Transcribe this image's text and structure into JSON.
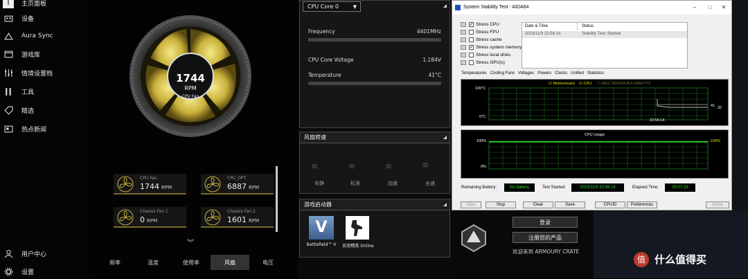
{
  "sidebar": {
    "items": [
      {
        "label": "主页面板",
        "icon": "home-icon"
      },
      {
        "label": "设备",
        "icon": "keyboard-icon"
      },
      {
        "label": "Aura Sync",
        "icon": "aura-icon"
      },
      {
        "label": "游戏库",
        "icon": "library-icon"
      },
      {
        "label": "情境设置档",
        "icon": "sliders-icon"
      },
      {
        "label": "工具",
        "icon": "tools-icon"
      },
      {
        "label": "精选",
        "icon": "tag-icon"
      },
      {
        "label": "热点新闻",
        "icon": "news-icon"
      }
    ],
    "bottom": [
      {
        "label": "用户中心",
        "icon": "user-icon"
      },
      {
        "label": "设置",
        "icon": "gear-icon"
      }
    ]
  },
  "main_fan": {
    "value": "1744",
    "unit": "RPM",
    "label": "CPU Fan"
  },
  "fan_cards": [
    {
      "name": "CPU Fan",
      "value": "1744",
      "unit": "RPM"
    },
    {
      "name": "CPU_OPT",
      "value": "6887",
      "unit": "RPM"
    },
    {
      "name": "Chassis Fan 1",
      "value": "0",
      "unit": "RPM"
    },
    {
      "name": "Chassis Fan 2",
      "value": "1601",
      "unit": "RPM"
    }
  ],
  "bottom_tabs": [
    "频率",
    "温度",
    "使用率",
    "风扇",
    "电压"
  ],
  "active_tab": 3,
  "cpu_panel": {
    "select": "CPU Core 0",
    "rows": [
      {
        "label": "Frequency",
        "value": "4401MHz"
      },
      {
        "label": "CPU Core Voltage",
        "value": "1.184V"
      },
      {
        "label": "Temperature",
        "value": "41°C"
      }
    ]
  },
  "fan_speed_panel": {
    "title": "风扇转速",
    "modes": [
      "安静",
      "标准",
      "加速",
      "全速"
    ]
  },
  "game_launcher": {
    "title": "游戏启动器",
    "games": [
      {
        "name": "Battlefield™ V"
      },
      {
        "name": "反恐精英 Online"
      }
    ]
  },
  "aida": {
    "title": "System Stability Test - AIDA64",
    "stress": [
      {
        "label": "Stress CPU",
        "checked": true
      },
      {
        "label": "Stress FPU",
        "checked": false
      },
      {
        "label": "Stress cache",
        "checked": false
      },
      {
        "label": "Stress system memory",
        "checked": true
      },
      {
        "label": "Stress local disks",
        "checked": false
      },
      {
        "label": "Stress GPU(s)",
        "checked": false
      }
    ],
    "log_headers": [
      "Date & Time",
      "Status"
    ],
    "log_rows": [
      {
        "time": "2023/11/9 23:56:14",
        "status": "Stability Test: Started"
      }
    ],
    "tabs": [
      "Temperatures",
      "Cooling Fans",
      "Voltages",
      "Powers",
      "Clocks",
      "Unified",
      "Statistics"
    ],
    "temp_graph": {
      "legend": [
        "Motherboard",
        "CPU",
        "WDC WD40PURX-64AKYY0"
      ],
      "y_top": "100°C",
      "y_bottom": "0°C",
      "time": "23:56:14",
      "right_values": [
        "41",
        "32"
      ]
    },
    "usage_graph": {
      "title": "CPU Usage",
      "y_top": "100%",
      "y_bottom": "0%",
      "right_value": "100%"
    },
    "remaining_battery_label": "Remaining Battery:",
    "remaining_battery": "No battery",
    "test_started_label": "Test Started:",
    "test_started": "2023/11/9 23:56:14",
    "elapsed_label": "Elapsed Time:",
    "elapsed": "00:07:25",
    "buttons": [
      "Start",
      "Stop",
      "Clear",
      "Save",
      "CPUID",
      "Preferences",
      "Close"
    ]
  },
  "crate": {
    "login": "登录",
    "register": "注册您的产品",
    "welcome": "欢迎来到 ARMOURY CRATE"
  },
  "watermark": "什么值得买",
  "colors": {
    "gold": "#c9b13a",
    "accent": "#7a6a2a",
    "graph_green": "#2ddc2d"
  }
}
